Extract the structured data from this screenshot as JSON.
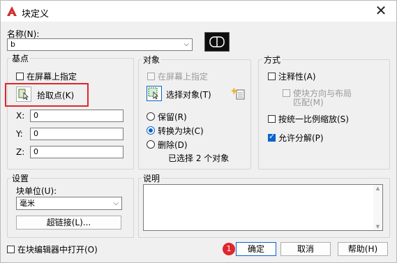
{
  "window": {
    "title": "块定义"
  },
  "name": {
    "label": "名称(N):",
    "value": "b"
  },
  "base_point": {
    "label": "基点",
    "specify_on_screen": "在屏幕上指定",
    "pick_point": "拾取点(K)",
    "x_label": "X:",
    "x_value": "0",
    "y_label": "Y:",
    "y_value": "0",
    "z_label": "Z:",
    "z_value": "0"
  },
  "objects": {
    "label": "对象",
    "specify_on_screen": "在屏幕上指定",
    "select_objects": "选择对象(T)",
    "retain": "保留(R)",
    "convert_to_block": "转换为块(C)",
    "delete": "删除(D)",
    "selected_count": "已选择 2 个对象"
  },
  "behavior": {
    "label": "方式",
    "annotative": "注释性(A)",
    "match_orientation": "使块方向与布局",
    "match_orientation_2": "匹配(M)",
    "scale_uniformly": "按统一比例缩放(S)",
    "allow_exploding": "允许分解(P)"
  },
  "settings": {
    "label": "设置",
    "block_unit_label": "块单位(U):",
    "block_unit_value": "毫米",
    "hyperlink": "超链接(L)..."
  },
  "description": {
    "label": "说明"
  },
  "footer": {
    "open_in_editor": "在块编辑器中打开(O)",
    "badge": "1",
    "ok": "确定",
    "cancel": "取消",
    "help": "帮助(H)"
  },
  "colors": {
    "accent": "#0a64c8",
    "highlight_box": "#e0262c",
    "badge": "#e0262c"
  }
}
